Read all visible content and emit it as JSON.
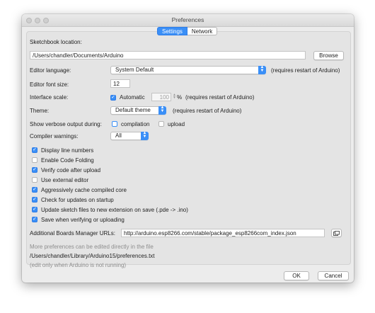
{
  "window": {
    "title": "Preferences"
  },
  "tabs": [
    {
      "label": "Settings"
    },
    {
      "label": "Network"
    }
  ],
  "sketchbook": {
    "label": "Sketchbook location:",
    "value": "/Users/chandler/Documents/Arduino",
    "browse_label": "Browse"
  },
  "editor_language": {
    "label": "Editor language:",
    "value": "System Default",
    "note": "(requires restart of Arduino)"
  },
  "font_size": {
    "label": "Editor font size:",
    "value": "12"
  },
  "interface_scale": {
    "label": "Interface scale:",
    "automatic_label": "Automatic",
    "automatic_checked": true,
    "value": "100",
    "unit": "%",
    "note": "(requires restart of Arduino)"
  },
  "theme": {
    "label": "Theme:",
    "value": "Default theme",
    "note": "(requires restart of Arduino)"
  },
  "verbose": {
    "label": "Show verbose output during:",
    "compilation_label": "compilation",
    "compilation_checked": false,
    "upload_label": "upload",
    "upload_checked": false
  },
  "compiler_warnings": {
    "label": "Compiler warnings:",
    "value": "All"
  },
  "options": [
    {
      "label": "Display line numbers",
      "checked": true
    },
    {
      "label": "Enable Code Folding",
      "checked": false
    },
    {
      "label": "Verify code after upload",
      "checked": true
    },
    {
      "label": "Use external editor",
      "checked": false
    },
    {
      "label": "Aggressively cache compiled core",
      "checked": true
    },
    {
      "label": "Check for updates on startup",
      "checked": true
    },
    {
      "label": "Update sketch files to new extension on save (.pde -> .ino)",
      "checked": true
    },
    {
      "label": "Save when verifying or uploading",
      "checked": true
    }
  ],
  "boards_manager": {
    "label": "Additional Boards Manager URLs:",
    "value": "http://arduino.esp8266.com/stable/package_esp8266com_index.json",
    "button_icon": "window-icon"
  },
  "footer_info": {
    "line1": "More preferences can be edited directly in the file",
    "path": "/Users/chandler/Library/Arduino15/preferences.txt",
    "line3": "(edit only when Arduino is not running)"
  },
  "buttons": {
    "ok": "OK",
    "cancel": "Cancel"
  },
  "colors": {
    "accent": "#3a8ff7",
    "panel": "#e4e4e4",
    "window": "#ececec"
  }
}
